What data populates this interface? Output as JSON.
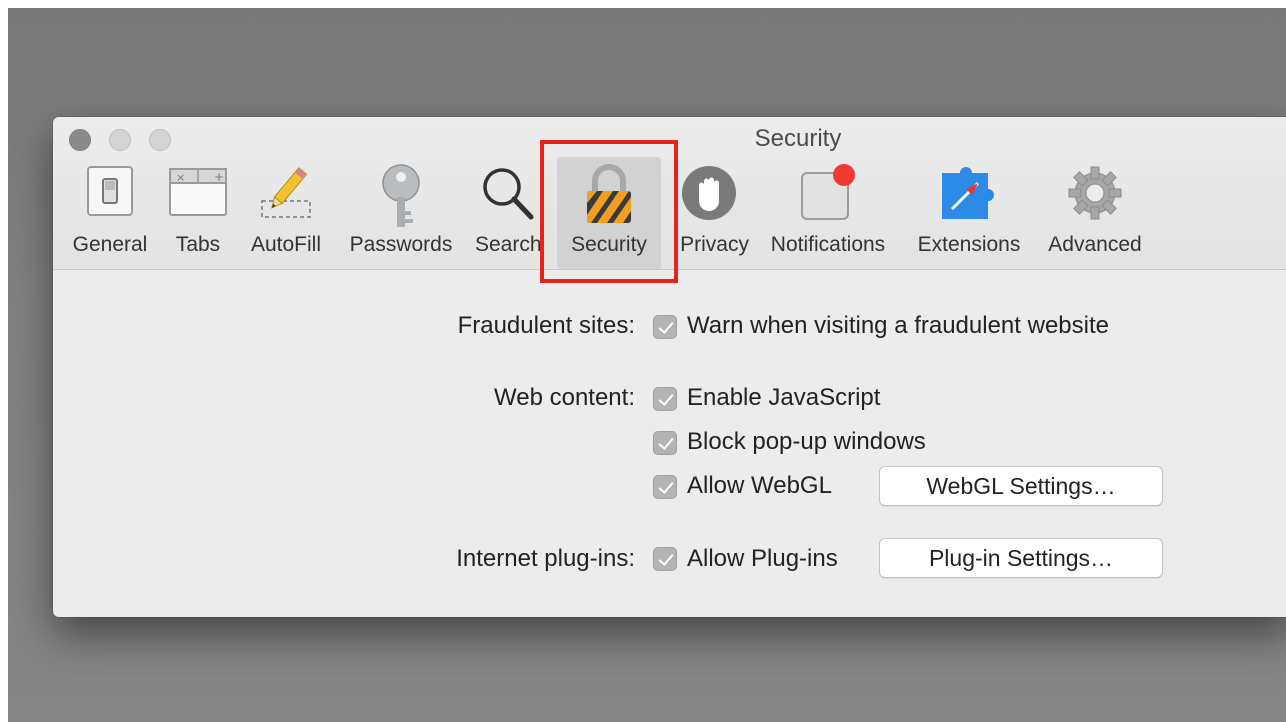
{
  "window": {
    "title": "Security"
  },
  "toolbar": {
    "tabs": [
      {
        "label": "General"
      },
      {
        "label": "Tabs"
      },
      {
        "label": "AutoFill"
      },
      {
        "label": "Passwords"
      },
      {
        "label": "Search"
      },
      {
        "label": "Security"
      },
      {
        "label": "Privacy"
      },
      {
        "label": "Notifications"
      },
      {
        "label": "Extensions"
      },
      {
        "label": "Advanced"
      }
    ],
    "selected": "Security",
    "highlight_color": "#e5231c"
  },
  "settings": {
    "fraudulent": {
      "label": "Fraudulent sites:",
      "options": [
        {
          "text": "Warn when visiting a fraudulent website",
          "checked": true
        }
      ]
    },
    "web_content": {
      "label": "Web content:",
      "options": [
        {
          "text": "Enable JavaScript",
          "checked": true
        },
        {
          "text": "Block pop-up windows",
          "checked": true
        },
        {
          "text": "Allow WebGL",
          "checked": true
        }
      ],
      "webgl_button": "WebGL Settings…"
    },
    "plugins": {
      "label": "Internet plug-ins:",
      "options": [
        {
          "text": "Allow Plug-ins",
          "checked": true
        }
      ],
      "plugin_button": "Plug-in Settings…"
    }
  }
}
